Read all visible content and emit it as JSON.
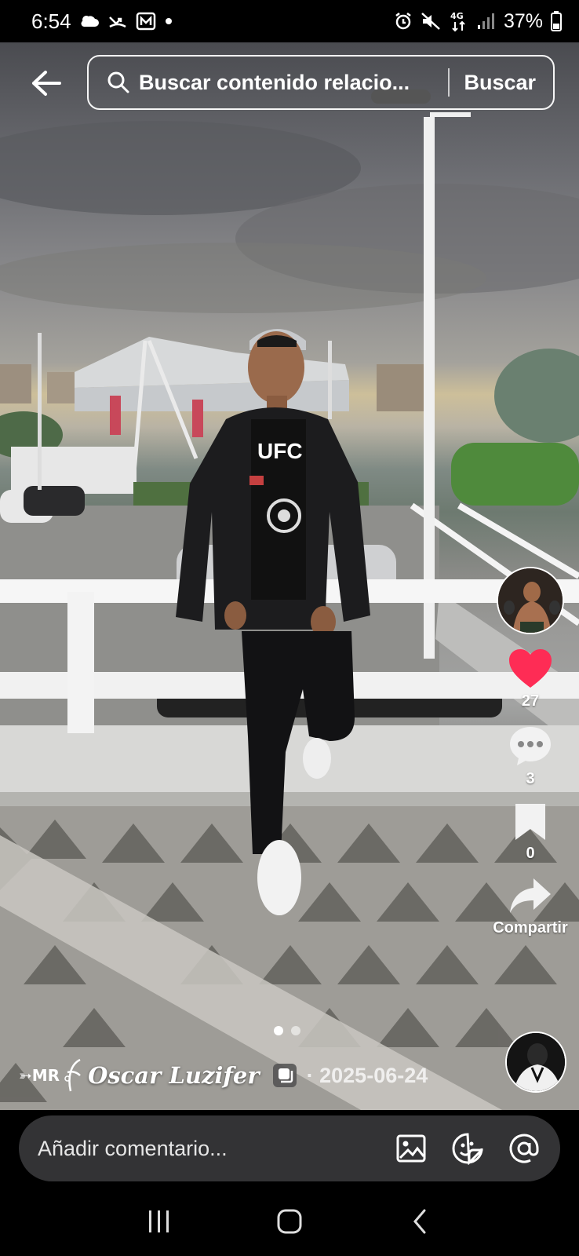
{
  "status_bar": {
    "time": "6:54",
    "network": "4G",
    "battery": "37%"
  },
  "search": {
    "query": "Buscar contenido relacio...",
    "button_label": "Buscar"
  },
  "actions": {
    "likes": "27",
    "comments": "3",
    "saves": "0",
    "share_label": "Compartir"
  },
  "post": {
    "author_prefix": "➳MR",
    "author_name": "Oscar Luzifer",
    "date": "· 2025-06-24",
    "shirt_text": "UFC",
    "image_index": 1,
    "image_count": 2
  },
  "comment_bar": {
    "placeholder": "Añadir comentario..."
  },
  "colors": {
    "like_heart": "#fe2c55",
    "background": "#000000",
    "comment_bg": "#333335"
  },
  "icons": [
    "back-arrow-icon",
    "search-icon",
    "heart-icon",
    "comment-icon",
    "bookmark-icon",
    "share-icon",
    "copy-icon",
    "image-icon",
    "sticker-icon",
    "mention-icon",
    "recents-icon",
    "home-icon",
    "nav-back-icon"
  ]
}
